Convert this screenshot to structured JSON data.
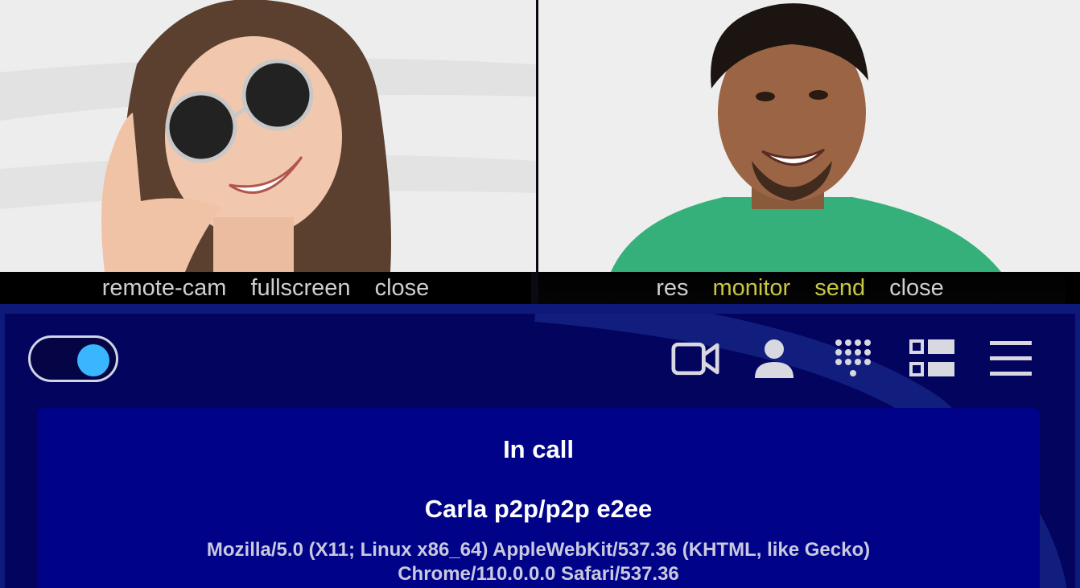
{
  "remote_tile": {
    "controls": [
      "remote-cam",
      "fullscreen",
      "close"
    ]
  },
  "local_tile": {
    "controls": [
      {
        "label": "res",
        "accent": false
      },
      {
        "label": "monitor",
        "accent": true
      },
      {
        "label": "send",
        "accent": true
      },
      {
        "label": "close",
        "accent": false
      }
    ]
  },
  "toolbar": {
    "toggle_state": "on",
    "icons": [
      "video-camera-icon",
      "user-icon",
      "dialpad-icon",
      "layout-icon",
      "menu-icon"
    ]
  },
  "call": {
    "status": "In call",
    "peer": "Carla p2p/p2p e2ee",
    "user_agent_line1": "Mozilla/5.0 (X11; Linux x86_64) AppleWebKit/537.36 (KHTML, like Gecko)",
    "user_agent_line2": "Chrome/110.0.0.0 Safari/537.36"
  },
  "colors": {
    "accent_yellow": "#c7c740",
    "toggle_knob": "#3ab6ff",
    "panel_bg": "#03045e",
    "card_bg": "#000388"
  }
}
